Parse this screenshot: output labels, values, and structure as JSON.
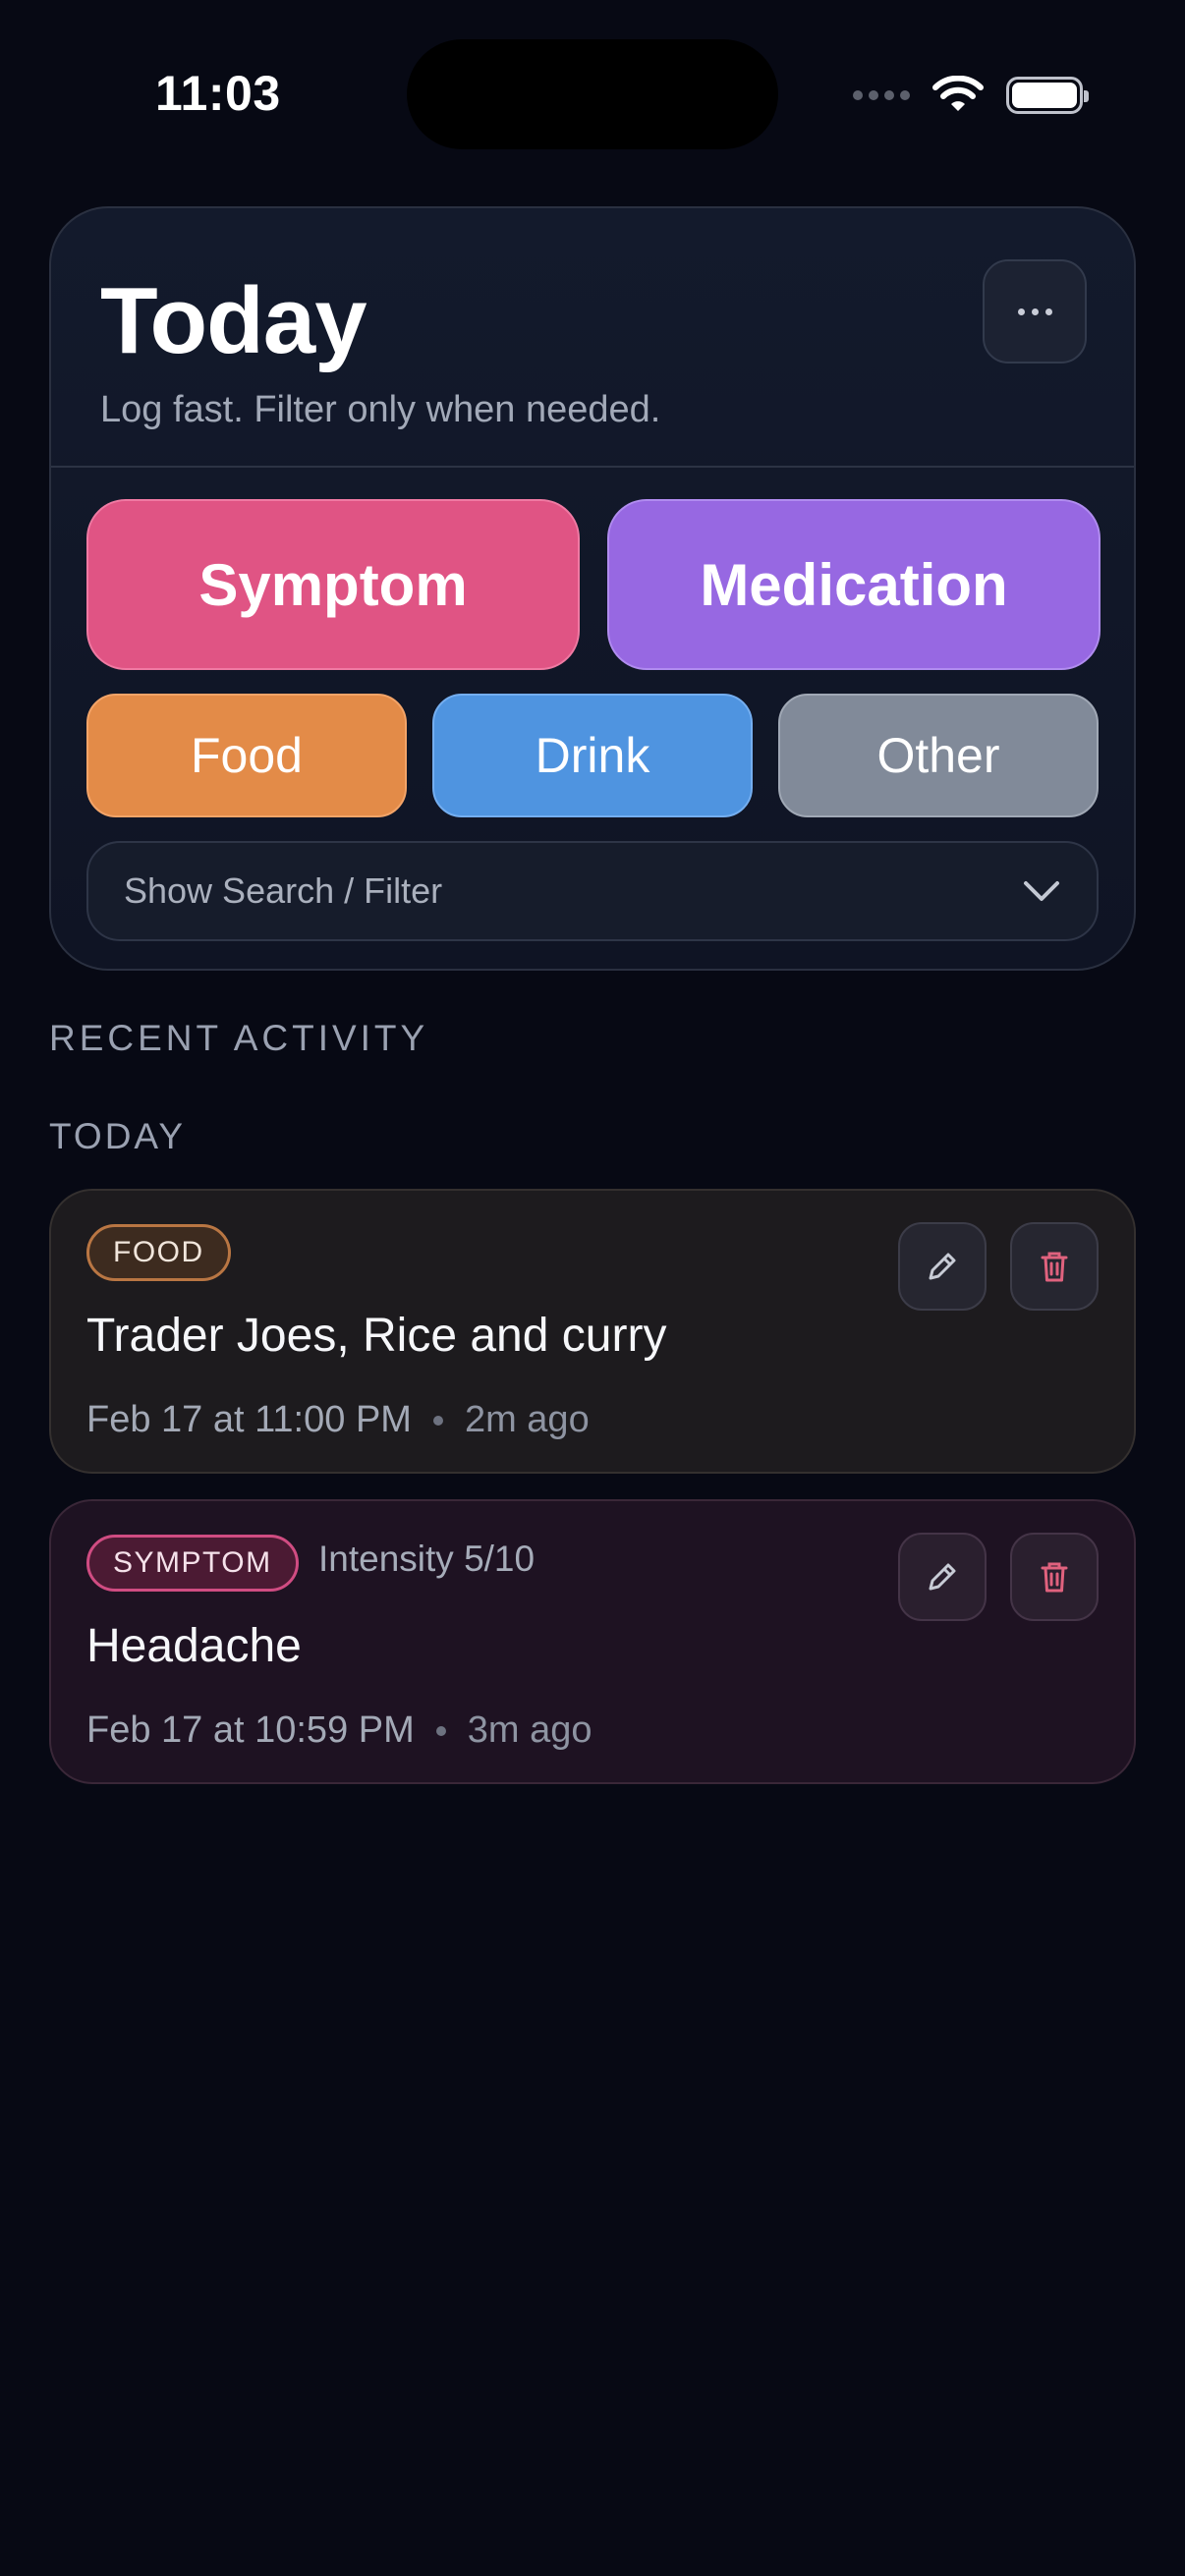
{
  "status_bar": {
    "time": "11:03"
  },
  "header": {
    "title": "Today",
    "subtitle": "Log fast. Filter only when needed."
  },
  "quick_log": {
    "symptom_label": "Symptom",
    "medication_label": "Medication",
    "food_label": "Food",
    "drink_label": "Drink",
    "other_label": "Other"
  },
  "filter": {
    "toggle_label": "Show Search / Filter"
  },
  "sections": {
    "recent_activity": "RECENT ACTIVITY",
    "today": "TODAY"
  },
  "entries": [
    {
      "category": "FOOD",
      "title": "Trader Joes, Rice and curry",
      "timestamp": "Feb 17 at 11:00 PM",
      "relative": "2m ago"
    },
    {
      "category": "SYMPTOM",
      "intensity": "Intensity 5/10",
      "title": "Headache",
      "timestamp": "Feb 17 at 10:59 PM",
      "relative": "3m ago"
    }
  ],
  "colors": {
    "symptom": "#e05484",
    "medication": "#9768e2",
    "food": "#e38b48",
    "drink": "#4f94e0",
    "other": "#818a99"
  },
  "icons": {
    "more": "ellipsis-icon",
    "filter_toggle": "chevron-down-icon",
    "edit": "pencil-icon",
    "delete": "trash-icon"
  }
}
